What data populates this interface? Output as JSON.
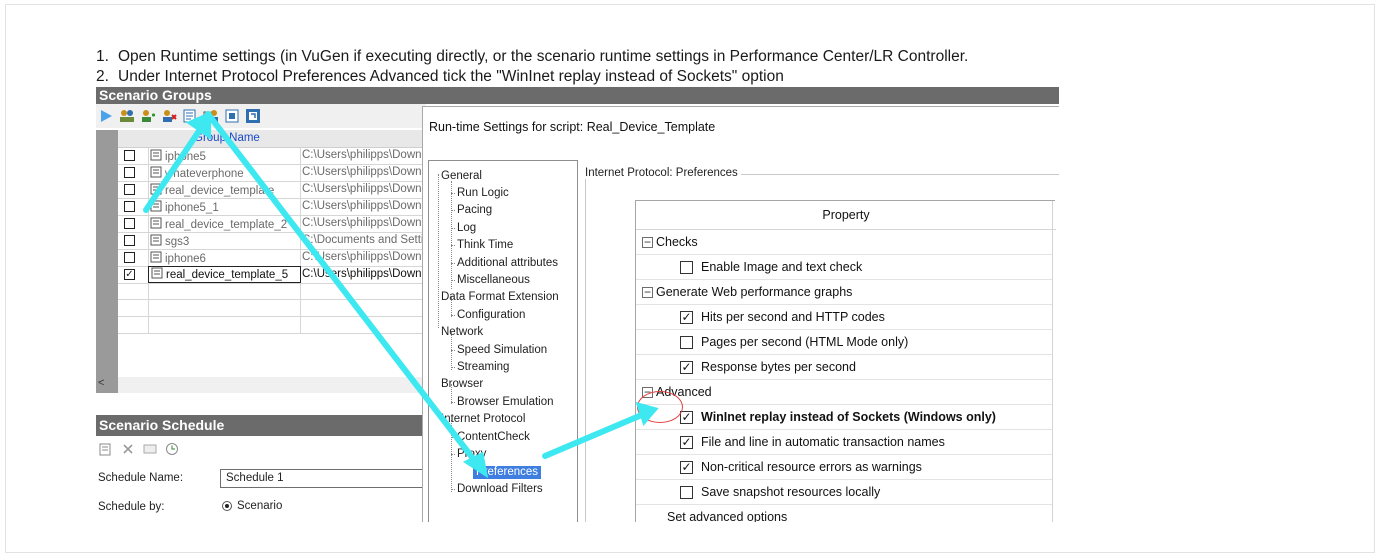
{
  "instructions": [
    {
      "num": "1.",
      "text": "Open Runtime settings (in VuGen if executing directly, or the scenario runtime settings in Performance Center/LR Controller."
    },
    {
      "num": "2.",
      "text": "Under Internet Protocol  Preferences  Advanced tick the \"WinInet replay instead of Sockets\" option"
    }
  ],
  "scenario_groups": {
    "title": "Scenario Groups",
    "header_label": "Group Name",
    "rows": [
      {
        "checked": false,
        "name": "iphone5",
        "path": "C:\\Users\\philipps\\Downl"
      },
      {
        "checked": false,
        "name": "whateverphone",
        "path": "C:\\Users\\philipps\\Downl"
      },
      {
        "checked": false,
        "name": "real_device_template",
        "path": "C:\\Users\\philipps\\Downl"
      },
      {
        "checked": false,
        "name": "iphone5_1",
        "path": "C:\\Users\\philipps\\Downl"
      },
      {
        "checked": false,
        "name": "real_device_template_2",
        "path": "C:\\Users\\philipps\\Downl"
      },
      {
        "checked": false,
        "name": "sgs3",
        "path": "C:\\Documents and Settir"
      },
      {
        "checked": false,
        "name": "iphone6",
        "path": "C:\\Users\\philipps\\Downl"
      },
      {
        "checked": true,
        "name": "real_device_template_5",
        "path": "C:\\Users\\philipps\\Downl"
      }
    ],
    "scroll_left": "<"
  },
  "scenario_schedule": {
    "title": "Scenario Schedule",
    "schedule_name_label": "Schedule Name:",
    "schedule_name_value": "Schedule 1",
    "schedule_by_label": "Schedule by:",
    "schedule_by_value": "Scenario"
  },
  "runtime_settings": {
    "title": "Run-time Settings for script: Real_Device_Template",
    "tree": {
      "general": "General",
      "run_logic": "Run Logic",
      "pacing": "Pacing",
      "log": "Log",
      "think_time": "Think Time",
      "additional_attributes": "Additional attributes",
      "miscellaneous": "Miscellaneous",
      "data_format_extension": "Data Format Extension",
      "configuration": "Configuration",
      "network": "Network",
      "speed_simulation": "Speed Simulation",
      "streaming": "Streaming",
      "browser": "Browser",
      "browser_emulation": "Browser Emulation",
      "internet_protocol": "Internet Protocol",
      "content_check": "ContentCheck",
      "proxy": "Proxy",
      "preferences": "Preferences",
      "download_filters": "Download Filters"
    },
    "group_legend": "Internet Protocol: Preferences",
    "property_header": "Property",
    "sections": {
      "checks": "Checks",
      "generate": "Generate Web performance graphs",
      "advanced": "Advanced"
    },
    "options": {
      "enable_image": {
        "label": "Enable Image and text check",
        "checked": false
      },
      "hits": {
        "label": "Hits per second and HTTP codes",
        "checked": true
      },
      "pages": {
        "label": "Pages per second (HTML Mode only)",
        "checked": false
      },
      "response_bytes": {
        "label": "Response bytes per second",
        "checked": true
      },
      "wininet": {
        "label": "WinInet replay instead of Sockets (Windows only)",
        "checked": true
      },
      "file_line": {
        "label": "File and line in automatic transaction names",
        "checked": true
      },
      "noncritical": {
        "label": "Non-critical resource errors as warnings",
        "checked": true
      },
      "snapshot": {
        "label": "Save snapshot resources locally",
        "checked": false
      }
    },
    "set_advanced": "Set advanced options"
  },
  "colors": {
    "arrow": "#3ee8f0",
    "highlight_ring": "#e04040",
    "selection": "#3d7ee0",
    "title_bar": "#6b6b6b"
  }
}
